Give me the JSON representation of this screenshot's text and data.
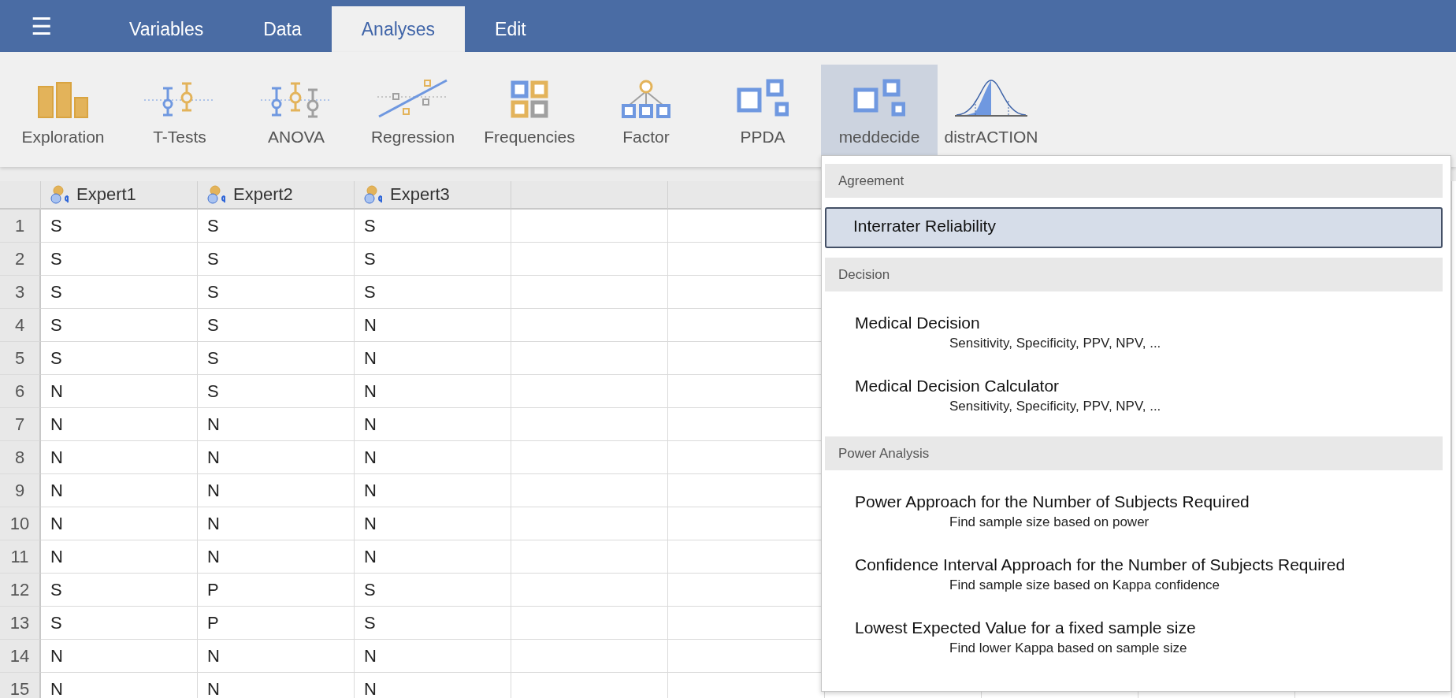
{
  "menu_button": {
    "icon": "☰"
  },
  "tabs": [
    {
      "label": "Variables",
      "selected": false
    },
    {
      "label": "Data",
      "selected": false
    },
    {
      "label": "Analyses",
      "selected": true
    },
    {
      "label": "Edit",
      "selected": false
    }
  ],
  "toolbar": [
    {
      "label": "Exploration",
      "selected": false
    },
    {
      "label": "T-Tests",
      "selected": false
    },
    {
      "label": "ANOVA",
      "selected": false
    },
    {
      "label": "Regression",
      "selected": false
    },
    {
      "label": "Frequencies",
      "selected": false
    },
    {
      "label": "Factor",
      "selected": false
    },
    {
      "label": "PPDA",
      "selected": false
    },
    {
      "label": "meddecide",
      "selected": true
    },
    {
      "label": "distrACTION",
      "selected": false
    }
  ],
  "table": {
    "columns": [
      "Expert1",
      "Expert2",
      "Expert3"
    ],
    "rows": [
      {
        "number": "1",
        "cells": [
          "S",
          "S",
          "S"
        ]
      },
      {
        "number": "2",
        "cells": [
          "S",
          "S",
          "S"
        ]
      },
      {
        "number": "3",
        "cells": [
          "S",
          "S",
          "S"
        ]
      },
      {
        "number": "4",
        "cells": [
          "S",
          "S",
          "N"
        ]
      },
      {
        "number": "5",
        "cells": [
          "S",
          "S",
          "N"
        ]
      },
      {
        "number": "6",
        "cells": [
          "N",
          "S",
          "N"
        ]
      },
      {
        "number": "7",
        "cells": [
          "N",
          "N",
          "N"
        ]
      },
      {
        "number": "8",
        "cells": [
          "N",
          "N",
          "N"
        ]
      },
      {
        "number": "9",
        "cells": [
          "N",
          "N",
          "N"
        ]
      },
      {
        "number": "10",
        "cells": [
          "N",
          "N",
          "N"
        ]
      },
      {
        "number": "11",
        "cells": [
          "N",
          "N",
          "N"
        ]
      },
      {
        "number": "12",
        "cells": [
          "S",
          "P",
          "S"
        ]
      },
      {
        "number": "13",
        "cells": [
          "S",
          "P",
          "S"
        ]
      },
      {
        "number": "14",
        "cells": [
          "N",
          "N",
          "N"
        ]
      },
      {
        "number": "15",
        "cells": [
          "N",
          "N",
          "N"
        ]
      }
    ]
  },
  "dropdown_menu": {
    "sections": [
      {
        "heading": "Agreement",
        "items": [
          {
            "title": "Interrater Reliability",
            "selected": true
          }
        ]
      },
      {
        "heading": "Decision",
        "items": [
          {
            "title": "Medical Decision",
            "subtitle": "Sensitivity, Specificity, PPV, NPV, ...",
            "selected": false
          },
          {
            "title": "Medical Decision Calculator",
            "subtitle": "Sensitivity, Specificity, PPV, NPV, ...",
            "selected": false
          }
        ]
      },
      {
        "heading": "Power Analysis",
        "items": [
          {
            "title": "Power Approach for the Number of Subjects Required",
            "subtitle": "Find sample size based on power",
            "selected": false
          },
          {
            "title": "Confidence Interval Approach for the Number of Subjects Required",
            "subtitle": "Find sample size based on Kappa confidence",
            "selected": false
          },
          {
            "title": "Lowest Expected Value for a fixed sample size",
            "subtitle": "Find lower Kappa based on sample size",
            "selected": false
          }
        ]
      }
    ]
  }
}
